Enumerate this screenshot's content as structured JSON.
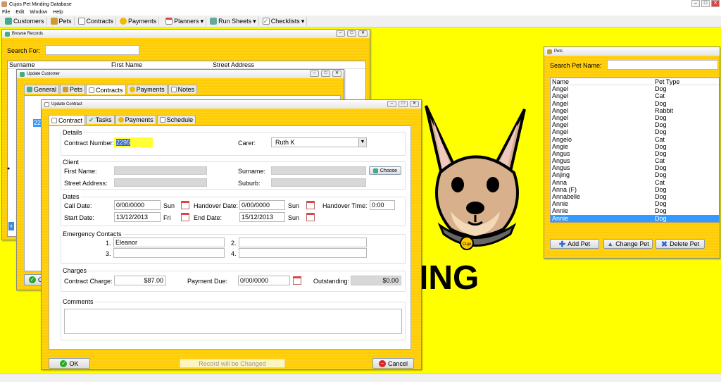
{
  "app": {
    "title": "Cujos Pet Minding Database",
    "menu": [
      "File",
      "Edit",
      "Window",
      "Help"
    ]
  },
  "toolbar": {
    "customers": "Customers",
    "pets": "Pets",
    "contracts": "Contracts",
    "payments": "Payments",
    "planners": "Planners",
    "run_sheets": "Run Sheets",
    "checklists": "Checklists"
  },
  "browse": {
    "title": "Browse Records",
    "search_label": "Search For:",
    "cols": [
      "Surname",
      "First Name",
      "Street Address"
    ],
    "ok_label": "O"
  },
  "update_customer": {
    "title": "Update Customer",
    "tabs": [
      "General",
      "Pets",
      "Contracts",
      "Payments",
      "Notes"
    ],
    "selected_tab": "Contracts",
    "row_value": "22"
  },
  "update_contract": {
    "title": "Update Contract",
    "tabs": [
      "Contract",
      "Tasks",
      "Payments",
      "Schedule"
    ],
    "details": {
      "group": "Details",
      "contract_number_label": "Contract Number:",
      "contract_number": "2295",
      "carer_label": "Carer:",
      "carer": "Ruth K"
    },
    "client": {
      "group": "Client",
      "first_name_label": "First Name:",
      "surname_label": "Surname:",
      "choose_label": "Choose",
      "street_label": "Street Address:",
      "suburb_label": "Suburb:"
    },
    "dates": {
      "group": "Dates",
      "call_date_label": "Call Date:",
      "call_date": "0/00/0000",
      "call_day": "Sun",
      "handover_date_label": "Handover Date:",
      "handover_date": "0/00/0000",
      "handover_day": "Sun",
      "handover_time_label": "Handover Time:",
      "handover_time": "0:00",
      "start_date_label": "Start Date:",
      "start_date": "13/12/2013",
      "start_day": "Fri",
      "end_date_label": "End Date:",
      "end_date": "15/12/2013",
      "end_day": "Sun"
    },
    "emergency": {
      "group": "Emergency Contacts",
      "n1": "1.",
      "n2": "2.",
      "n3": "3.",
      "n4": "4.",
      "contact1": "Eleanor"
    },
    "charges": {
      "group": "Charges",
      "contract_charge_label": "Contract Charge:",
      "contract_charge": "$87.00",
      "payment_due_label": "Payment Due:",
      "payment_due": "0/00/0000",
      "outstanding_label": "Outstanding:",
      "outstanding": "$0.00"
    },
    "comments": {
      "group": "Comments"
    },
    "ok_label": "OK",
    "status": "Record will be Changed",
    "cancel_label": "Cancel"
  },
  "pets": {
    "title": "Pets",
    "search_label": "Search Pet Name:",
    "col_name": "Name",
    "col_type": "Pet Type",
    "rows": [
      {
        "name": "Angel",
        "type": "Dog"
      },
      {
        "name": "Angel",
        "type": "Cat"
      },
      {
        "name": "Angel",
        "type": "Dog"
      },
      {
        "name": "Angel",
        "type": "Rabbit"
      },
      {
        "name": "Angel",
        "type": "Dog"
      },
      {
        "name": "Angel",
        "type": "Dog"
      },
      {
        "name": "Angel",
        "type": "Dog"
      },
      {
        "name": "Angelo",
        "type": "Cat"
      },
      {
        "name": "Angie",
        "type": "Dog"
      },
      {
        "name": "Angus",
        "type": "Dog"
      },
      {
        "name": "Angus",
        "type": "Cat"
      },
      {
        "name": "Angus",
        "type": "Dog"
      },
      {
        "name": "Anjing",
        "type": "Dog"
      },
      {
        "name": "Anna",
        "type": "Cat"
      },
      {
        "name": "Anna (F)",
        "type": "Dog"
      },
      {
        "name": "Annabelle",
        "type": "Dog"
      },
      {
        "name": "Annie",
        "type": "Dog"
      },
      {
        "name": "Annie",
        "type": "Dog"
      },
      {
        "name": "Annie",
        "type": "Dog"
      }
    ],
    "add_label": "Add Pet",
    "change_label": "Change Pet",
    "delete_label": "Delete Pet"
  },
  "logo": {
    "text": "ING",
    "tag": "Cujo"
  }
}
